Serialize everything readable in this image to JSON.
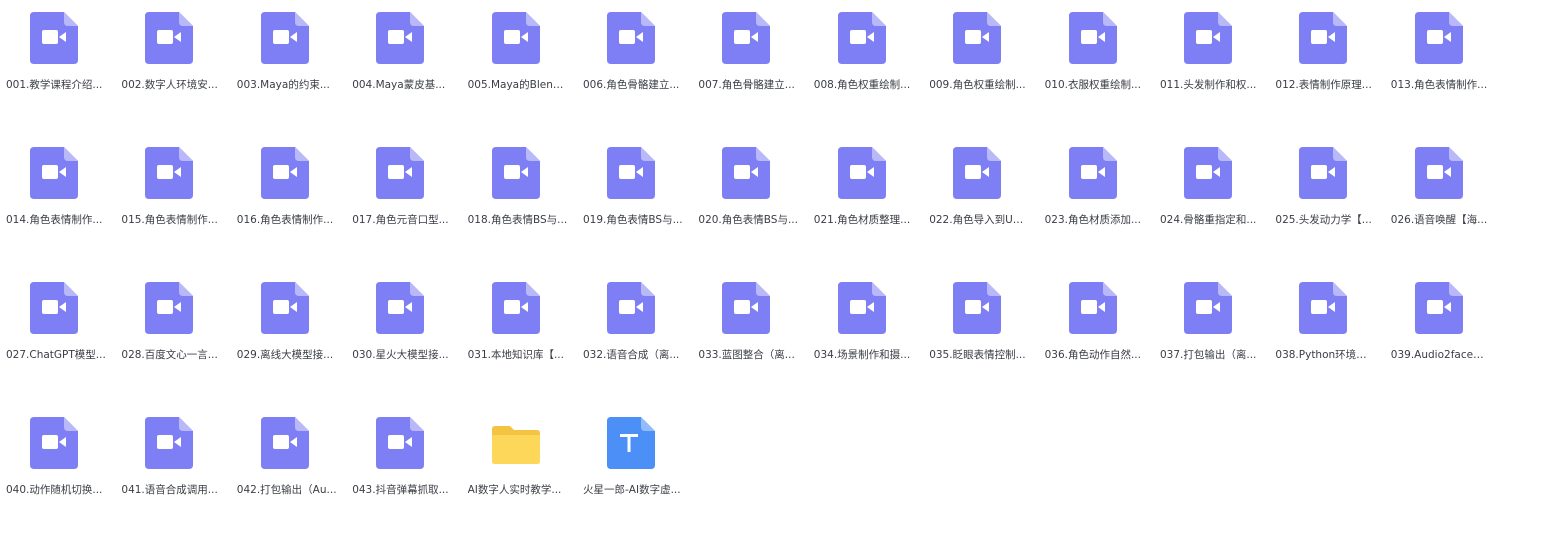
{
  "colors": {
    "video_icon": "#7f7ff5",
    "video_fold": "#b9b9fa",
    "folder_back": "#f5c342",
    "folder_front": "#fdd75a",
    "text_doc": "#4b8ff7",
    "label_text": "#3a3d45"
  },
  "files": [
    {
      "name": "001.教学课程介绍...",
      "icon": "video-file-icon"
    },
    {
      "name": "002.数字人环境安...",
      "icon": "video-file-icon"
    },
    {
      "name": "003.Maya的约束...",
      "icon": "video-file-icon"
    },
    {
      "name": "004.Maya蒙皮基...",
      "icon": "video-file-icon"
    },
    {
      "name": "005.Maya的Blend...",
      "icon": "video-file-icon"
    },
    {
      "name": "006.角色骨骼建立...",
      "icon": "video-file-icon"
    },
    {
      "name": "007.角色骨骼建立...",
      "icon": "video-file-icon"
    },
    {
      "name": "008.角色权重绘制...",
      "icon": "video-file-icon"
    },
    {
      "name": "009.角色权重绘制...",
      "icon": "video-file-icon"
    },
    {
      "name": "010.衣服权重绘制...",
      "icon": "video-file-icon"
    },
    {
      "name": "011.头发制作和权...",
      "icon": "video-file-icon"
    },
    {
      "name": "012.表情制作原理...",
      "icon": "video-file-icon"
    },
    {
      "name": "013.角色表情制作...",
      "icon": "video-file-icon"
    },
    {
      "name": "014.角色表情制作...",
      "icon": "video-file-icon"
    },
    {
      "name": "015.角色表情制作...",
      "icon": "video-file-icon"
    },
    {
      "name": "016.角色表情制作...",
      "icon": "video-file-icon"
    },
    {
      "name": "017.角色元音口型...",
      "icon": "video-file-icon"
    },
    {
      "name": "018.角色表情BS与...",
      "icon": "video-file-icon"
    },
    {
      "name": "019.角色表情BS与...",
      "icon": "video-file-icon"
    },
    {
      "name": "020.角色表情BS与...",
      "icon": "video-file-icon"
    },
    {
      "name": "021.角色材质整理...",
      "icon": "video-file-icon"
    },
    {
      "name": "022.角色导入到UE...",
      "icon": "video-file-icon"
    },
    {
      "name": "023.角色材质添加...",
      "icon": "video-file-icon"
    },
    {
      "name": "024.骨骼重指定和...",
      "icon": "video-file-icon"
    },
    {
      "name": "025.头发动力学【...",
      "icon": "video-file-icon"
    },
    {
      "name": "026.语音唤醒【海...",
      "icon": "video-file-icon"
    },
    {
      "name": "027.ChatGPT模型...",
      "icon": "video-file-icon"
    },
    {
      "name": "028.百度文心一言...",
      "icon": "video-file-icon"
    },
    {
      "name": "029.离线大模型接...",
      "icon": "video-file-icon"
    },
    {
      "name": "030.星火大模型接...",
      "icon": "video-file-icon"
    },
    {
      "name": "031.本地知识库【...",
      "icon": "video-file-icon"
    },
    {
      "name": "032.语音合成（离...",
      "icon": "video-file-icon"
    },
    {
      "name": "033.蓝图整合（离...",
      "icon": "video-file-icon"
    },
    {
      "name": "034.场景制作和摄...",
      "icon": "video-file-icon"
    },
    {
      "name": "035.眨眼表情控制...",
      "icon": "video-file-icon"
    },
    {
      "name": "036.角色动作自然...",
      "icon": "video-file-icon"
    },
    {
      "name": "037.打包输出（离...",
      "icon": "video-file-icon"
    },
    {
      "name": "038.Python环境安...",
      "icon": "video-file-icon"
    },
    {
      "name": "039.Audio2face接...",
      "icon": "video-file-icon"
    },
    {
      "name": "040.动作随机切换...",
      "icon": "video-file-icon"
    },
    {
      "name": "041.语音合成调用...",
      "icon": "video-file-icon"
    },
    {
      "name": "042.打包输出（Au...",
      "icon": "video-file-icon"
    },
    {
      "name": "043.抖音弹幕抓取...",
      "icon": "video-file-icon"
    },
    {
      "name": "AI数字人实时教学...",
      "icon": "folder-icon"
    },
    {
      "name": "火星一郎-AI数字虚...",
      "icon": "text-file-icon"
    }
  ]
}
